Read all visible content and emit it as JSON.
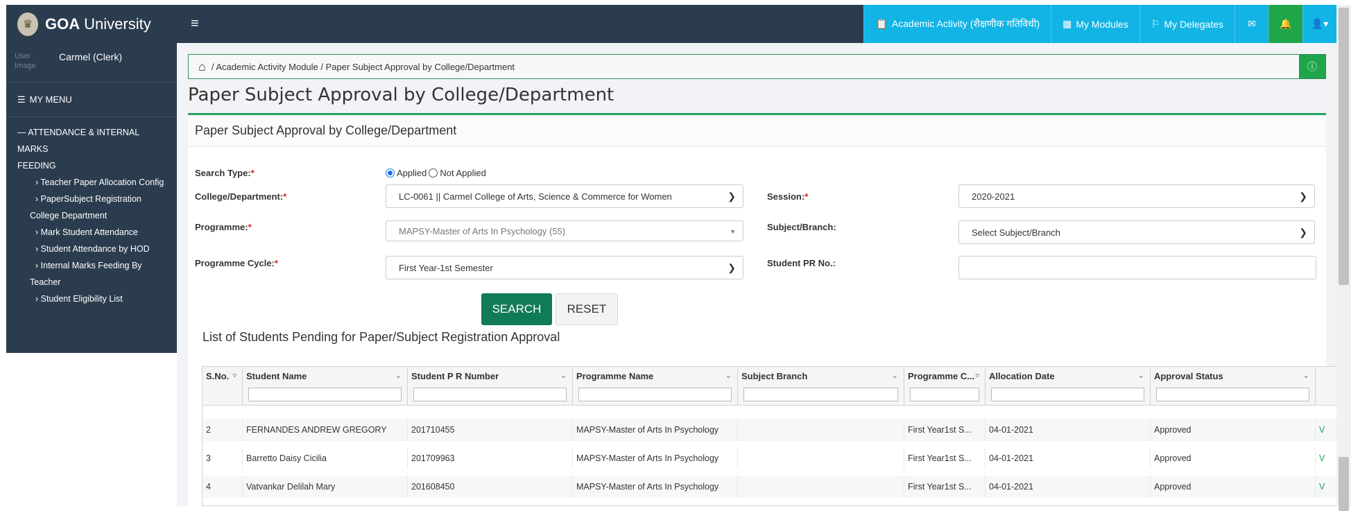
{
  "topbar": {
    "brand_bold": "GOA",
    "brand_rest": "University",
    "academic_activity": "Academic Activity (शैक्षणीक गतिविधी)",
    "my_modules": "My Modules",
    "my_delegates": "My Delegates"
  },
  "sidebar": {
    "user_image_alt": "User Image",
    "user_name": "Carmel (Clerk)",
    "menu_header": "MY MENU",
    "section_line1": "ATTENDANCE & INTERNAL MARKS",
    "section_line2": "FEEDING",
    "items": [
      "Teacher Paper Allocation Config",
      "PaperSubject Registration",
      "College Department",
      "Mark Student Attendance",
      "Student Attendance by HOD",
      "Internal Marks Feeding By",
      "Teacher",
      "Student Eligibility List"
    ]
  },
  "breadcrumb": "/ Academic Activity Module / Paper Subject Approval by College/Department",
  "page_title": "Paper Subject Approval by College/Department",
  "panel_title": "Paper Subject Approval by College/Department",
  "form": {
    "search_type_label": "Search Type:",
    "applied": "Applied",
    "not_applied": "Not Applied",
    "college_label": "College/Department:",
    "college_value": "LC-0061 || Carmel College of Arts, Science & Commerce for Women",
    "session_label": "Session:",
    "session_value": "2020-2021",
    "programme_label": "Programme:",
    "programme_value": "MAPSY-Master of Arts In Psychology (55)",
    "subject_label": "Subject/Branch:",
    "subject_value": "Select Subject/Branch",
    "cycle_label": "Programme Cycle:",
    "cycle_value": "First Year-1st Semester",
    "pr_label": "Student PR No.:",
    "pr_value": "",
    "search_btn": "SEARCH",
    "reset_btn": "RESET"
  },
  "list_title": "List of Students Pending for Paper/Subject Registration Approval",
  "grid": {
    "columns": [
      "S.No.",
      "Student Name",
      "Student P R Number",
      "Programme Name",
      "Subject Branch",
      "Programme C...",
      "Allocation Date",
      "Approval Status"
    ],
    "rows": [
      [
        "2",
        "FERNANDES ANDREW GREGORY",
        "201710455",
        "MAPSY-Master of Arts In Psychology",
        "",
        "First Year1st S...",
        "04-01-2021",
        "Approved"
      ],
      [
        "3",
        "Barretto Daisy Cicilia",
        "201709963",
        "MAPSY-Master of Arts In Psychology",
        "",
        "First Year1st S...",
        "04-01-2021",
        "Approved"
      ],
      [
        "4",
        "Vatvankar Delilah Mary",
        "201608450",
        "MAPSY-Master of Arts In Psychology",
        "",
        "First Year1st S...",
        "04-01-2021",
        "Approved"
      ]
    ],
    "link_char": "V"
  }
}
